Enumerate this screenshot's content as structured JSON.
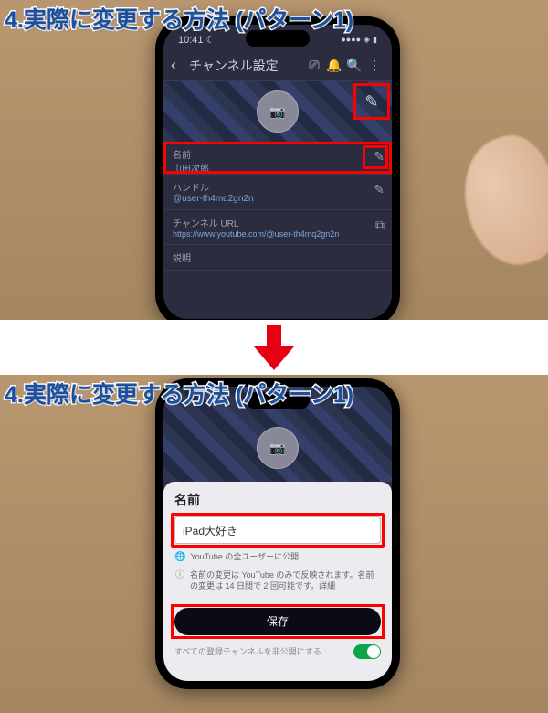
{
  "overlay": {
    "title": "4.実際に変更する方法 (パターン1)"
  },
  "status": {
    "time": "10:41",
    "moon": "☾",
    "signal": "●●●●",
    "wifi": "◈",
    "battery": "▮"
  },
  "appbar": {
    "back": "‹",
    "title": "チャンネル設定",
    "icons": {
      "cast": "⎚",
      "bell": "🔔",
      "search": "🔍",
      "more": "⋮"
    }
  },
  "avatar_icon": "📷",
  "pencil_icon": "✎",
  "copy_icon": "⧉",
  "rows": {
    "name": {
      "label": "名前",
      "value": "山田次郎"
    },
    "handle": {
      "label": "ハンドル",
      "value": "@user-th4mq2gn2n"
    },
    "url": {
      "label": "チャンネル URL",
      "value": "https://www.youtube.com/@user-th4mq2gn2n"
    },
    "desc": {
      "label": "説明"
    }
  },
  "sheet": {
    "heading": "名前",
    "input_value": "iPad大好き",
    "visibility": "YouTube の全ユーザーに公開",
    "info": "名前の変更は YouTube のみで反映されます。名前の変更は 14 日間で 2 回可能です。詳細",
    "save": "保存",
    "footer": "すべての登録チャンネルを非公開にする"
  },
  "globe_icon": "🌐",
  "info_icon": "ⓘ"
}
